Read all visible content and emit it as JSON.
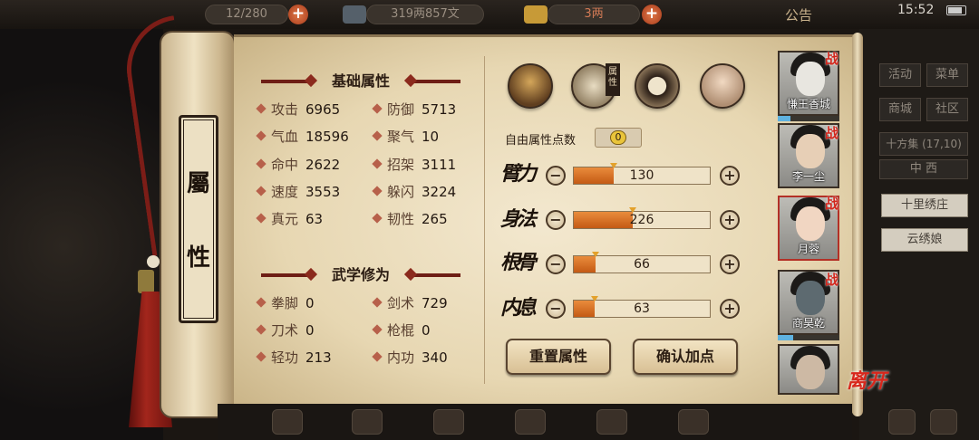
{
  "topbar": {
    "resource1": "12/280",
    "resource2": "319两857文",
    "resource3": "3两",
    "announcement": "公告",
    "clock": "15:52"
  },
  "scroll_title": [
    "屬",
    "性"
  ],
  "basic_attributes": {
    "title": "基础属性",
    "stats": [
      {
        "label": "攻击",
        "value": "6965"
      },
      {
        "label": "防御",
        "value": "5713"
      },
      {
        "label": "气血",
        "value": "18596"
      },
      {
        "label": "聚气",
        "value": "10"
      },
      {
        "label": "命中",
        "value": "2622"
      },
      {
        "label": "招架",
        "value": "3111"
      },
      {
        "label": "速度",
        "value": "3553"
      },
      {
        "label": "躲闪",
        "value": "3224"
      },
      {
        "label": "真元",
        "value": "63"
      },
      {
        "label": "韧性",
        "value": "265"
      }
    ]
  },
  "martial": {
    "title": "武学修为",
    "stats": [
      {
        "label": "拳脚",
        "value": "0"
      },
      {
        "label": "剑术",
        "value": "729"
      },
      {
        "label": "刀术",
        "value": "0"
      },
      {
        "label": "枪棍",
        "value": "0"
      },
      {
        "label": "轻功",
        "value": "213"
      },
      {
        "label": "内功",
        "value": "340"
      }
    ]
  },
  "tabs": {
    "attribute_tag": "属性",
    "icons": [
      "hat-figure-icon",
      "attribute-book-icon",
      "bagua-icon",
      "meridian-body-icon"
    ]
  },
  "allocation": {
    "free_points_label": "自由属性点数",
    "free_points": "0",
    "attributes": [
      {
        "name": "臂力",
        "value": "130",
        "fill": 0.29
      },
      {
        "name": "身法",
        "value": "226",
        "fill": 0.43
      },
      {
        "name": "根骨",
        "value": "66",
        "fill": 0.16
      },
      {
        "name": "内息",
        "value": "63",
        "fill": 0.15
      }
    ],
    "reset_label": "重置属性",
    "confirm_label": "确认加点"
  },
  "party": [
    {
      "name": "慊王香城",
      "war": "战",
      "exp": 0.2
    },
    {
      "name": "李一尘",
      "war": "战"
    },
    {
      "name": "月蓉",
      "war": "战"
    },
    {
      "name": "商昊乾",
      "war": "战",
      "exp": 0.25
    },
    {
      "name": ""
    }
  ],
  "menu": {
    "activity": "活动",
    "menu": "菜单",
    "shop": "商城",
    "community": "社区",
    "location": "十方集",
    "coords": "(17,10)",
    "region": "中 西",
    "npc1": "十里绣庄",
    "npc2": "云绣娘"
  },
  "leave_label": "离开",
  "colors": {
    "accent_red": "#d2261c",
    "bar_orange": "#d86a22",
    "paper": "#efe3c6"
  }
}
